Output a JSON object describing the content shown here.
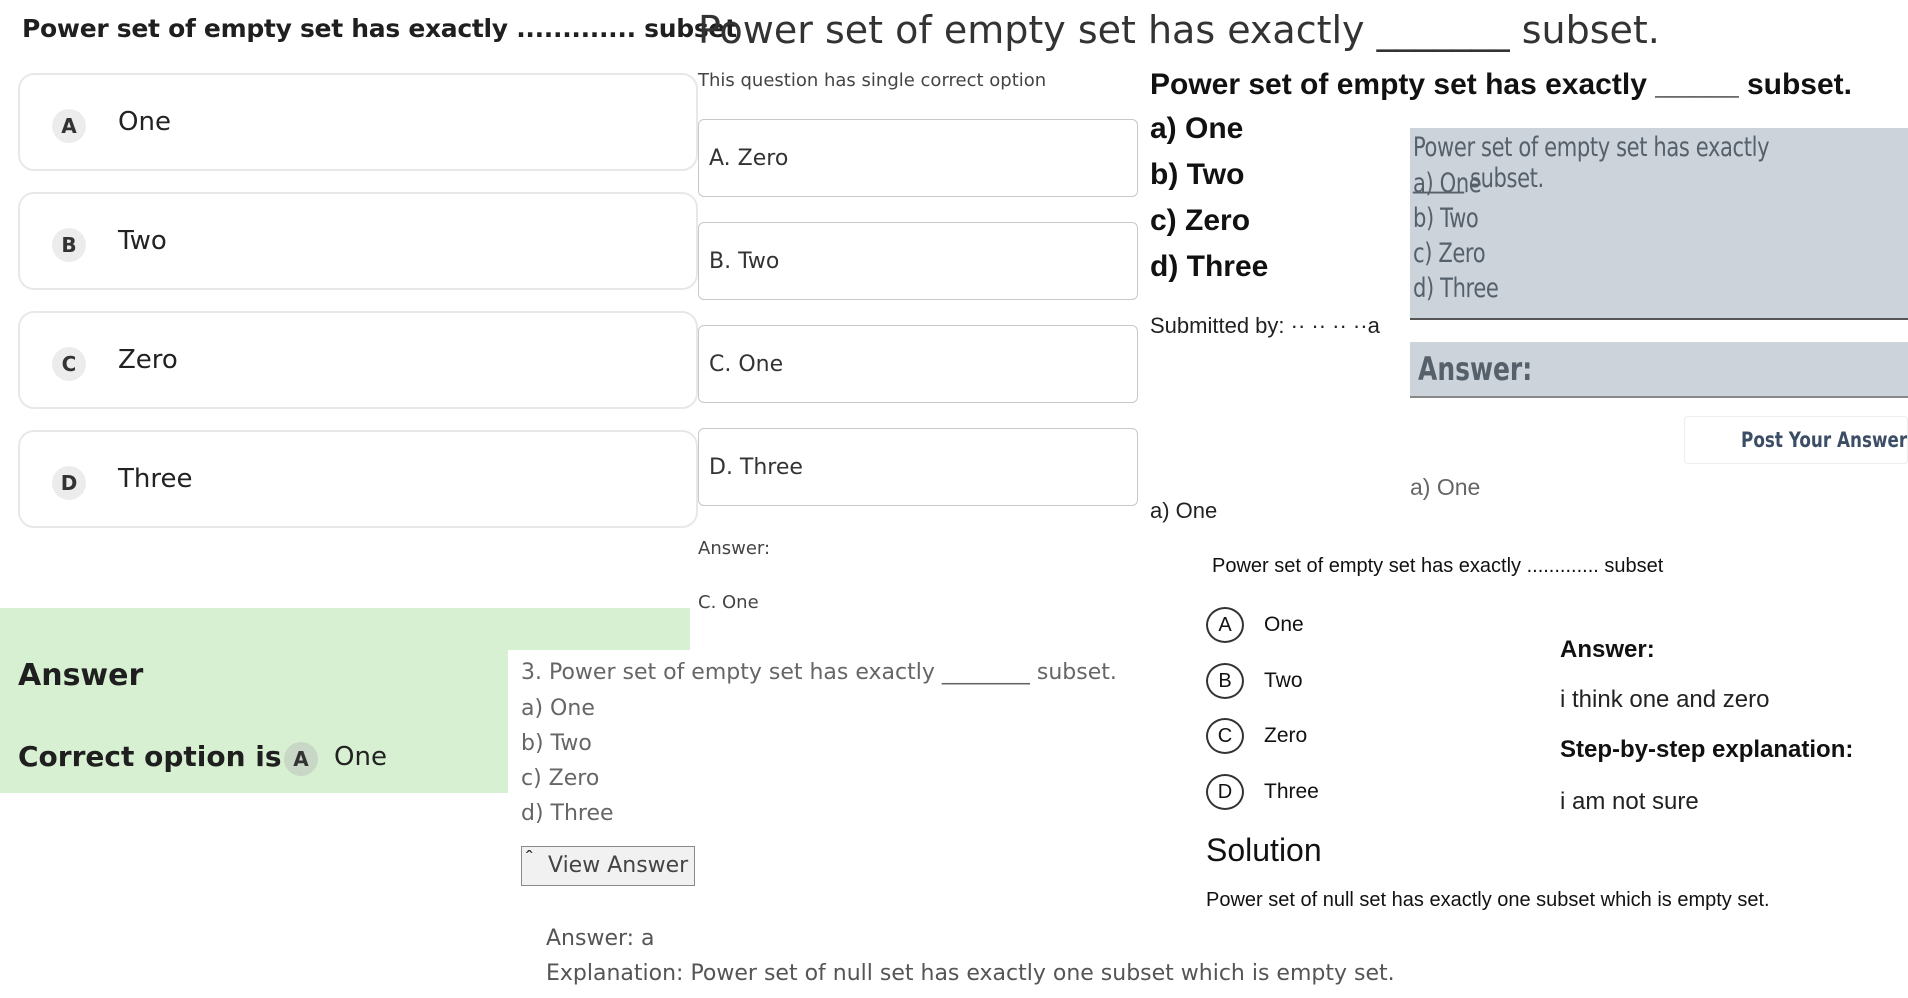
{
  "panel1": {
    "title": "Power set of empty set has exactly ............. subset",
    "options": [
      {
        "letter": "A",
        "label": "One"
      },
      {
        "letter": "B",
        "label": "Two"
      },
      {
        "letter": "C",
        "label": "Zero"
      },
      {
        "letter": "D",
        "label": "Three"
      }
    ],
    "answer_title": "Answer",
    "correct_prefix": "Correct option is",
    "correct_letter": "A",
    "correct_label": "One",
    "answer_bg": "#d8f0d2"
  },
  "panel2": {
    "title": "Power set of empty set has exactly _______ subset.",
    "subtitle": "This question has single correct option",
    "options": [
      "A. Zero",
      "B. Two",
      "C. One",
      "D. Three"
    ],
    "answer_label": "Answer:",
    "answer_value": "C. One"
  },
  "panel3": {
    "title": "Power set of empty set has exactly _____ subset.",
    "options": [
      "a) One",
      "b) Two",
      "c) Zero",
      "d) Three"
    ],
    "submitted_by": "Submitted by: ·· ·· ·· ··a",
    "answer": "a) One"
  },
  "panel4": {
    "lines": [
      "Power set of empty set has exactly _____ subset.",
      "a) One",
      "b) Two",
      "c) Zero",
      "d) Three"
    ],
    "answer_title": "Answer:",
    "post_button": "Post Your Answer ←",
    "answer": "a) One",
    "box_color": "#cdd3db"
  },
  "panel5": {
    "title": "Power set of empty set has exactly ............. subset",
    "options": [
      {
        "letter": "A",
        "label": "One"
      },
      {
        "letter": "B",
        "label": "Two"
      },
      {
        "letter": "C",
        "label": "Zero"
      },
      {
        "letter": "D",
        "label": "Three"
      }
    ],
    "solution_title": "Solution",
    "solution_text": "Power set of null set has exactly one subset which is empty set."
  },
  "panel6": {
    "answer_title": "Answer:",
    "answer_text": "i think one and zero",
    "step_title": "Step-by-step explanation:",
    "step_text": "i am not sure"
  },
  "panel7": {
    "question": "3. Power set of empty set has exactly ________ subset.",
    "options": [
      "a) One",
      "b) Two",
      "c) Zero",
      "d) Three"
    ],
    "view_button": "View Answer",
    "answer": "Answer: a",
    "explanation": "Explanation: Power set of null set has exactly one subset which is empty set."
  }
}
